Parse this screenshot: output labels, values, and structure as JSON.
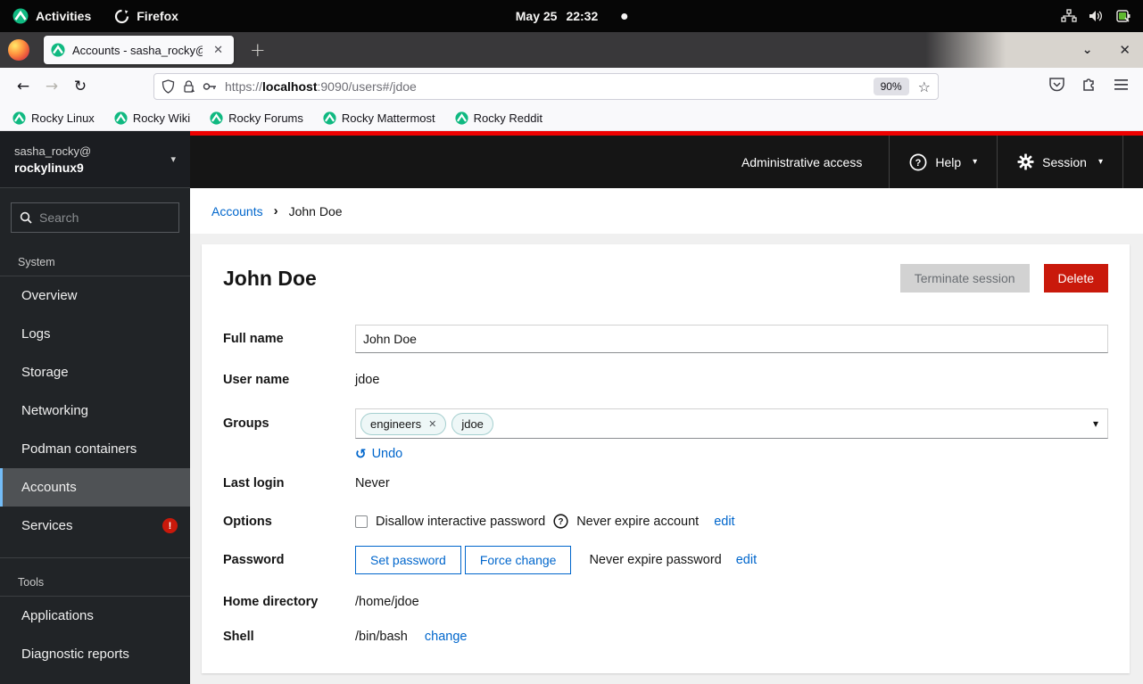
{
  "top_bar": {
    "activities_label": "Activities",
    "firefox_label": "Firefox",
    "clock_date": "May 25",
    "clock_time": "22:32"
  },
  "window": {
    "tab_title": "Accounts - sasha_rocky@",
    "tab_close": "✕",
    "new_tab": "+",
    "list_tabs": "⌄",
    "window_close": "✕"
  },
  "toolbar": {
    "back": "←",
    "forward": "→",
    "reload": "↻",
    "url_prefix": "https://",
    "url_host": "localhost",
    "url_suffix": ":9090/users#/jdoe",
    "zoom_level": "90%",
    "star": "☆"
  },
  "bookmarks": [
    {
      "label": "Rocky Linux"
    },
    {
      "label": "Rocky Wiki"
    },
    {
      "label": "Rocky Forums"
    },
    {
      "label": "Rocky Mattermost"
    },
    {
      "label": "Rocky Reddit"
    }
  ],
  "cockpit": {
    "user": "sasha_rocky@",
    "host": "rockylinux9",
    "search_placeholder": "Search",
    "masthead": {
      "admin_access": "Administrative access",
      "help": "Help",
      "session": "Session"
    },
    "nav": {
      "sections": [
        {
          "label": "System",
          "items": [
            {
              "label": "Overview"
            },
            {
              "label": "Logs"
            },
            {
              "label": "Storage"
            },
            {
              "label": "Networking"
            },
            {
              "label": "Podman containers"
            },
            {
              "label": "Accounts",
              "active": true
            },
            {
              "label": "Services",
              "badge": "!"
            }
          ]
        },
        {
          "label": "Tools",
          "items": [
            {
              "label": "Applications"
            },
            {
              "label": "Diagnostic reports"
            }
          ]
        }
      ]
    },
    "breadcrumb": {
      "parent": "Accounts",
      "separator": "›",
      "current": "John Doe"
    },
    "account": {
      "title": "John Doe",
      "terminate_button": "Terminate session",
      "delete_button": "Delete",
      "full_name_label": "Full name",
      "full_name_value": "John Doe",
      "user_name_label": "User name",
      "user_name_value": "jdoe",
      "groups_label": "Groups",
      "groups": [
        {
          "label": "engineers",
          "removable": true,
          "remove_icon": "✕"
        },
        {
          "label": "jdoe",
          "removable": false
        }
      ],
      "combo_caret": "▾",
      "undo_icon": "↺",
      "undo_label": "Undo",
      "last_login_label": "Last login",
      "last_login_value": "Never",
      "options_label": "Options",
      "disallow_label": "Disallow interactive password",
      "never_expire_account": "Never expire account",
      "options_edit_label": "edit",
      "password_label": "Password",
      "set_password_button": "Set password",
      "force_change_button": "Force change",
      "never_expire_password": "Never expire password",
      "password_edit_label": "edit",
      "home_dir_label": "Home directory",
      "home_dir_value": "/home/jdoe",
      "shell_label": "Shell",
      "shell_value": "/bin/bash",
      "change_label": "change"
    },
    "colors": {
      "masthead_accent": "#ee0000",
      "masthead_bg": "#151515",
      "sidebar_bg": "#212427",
      "active_item_border": "#73bcf7",
      "danger": "#c9190b",
      "link_blue": "#0066cc",
      "rocky_green": "#10b981",
      "chip_bg": "#eef7f7",
      "chip_border": "#a5cfcf"
    }
  }
}
